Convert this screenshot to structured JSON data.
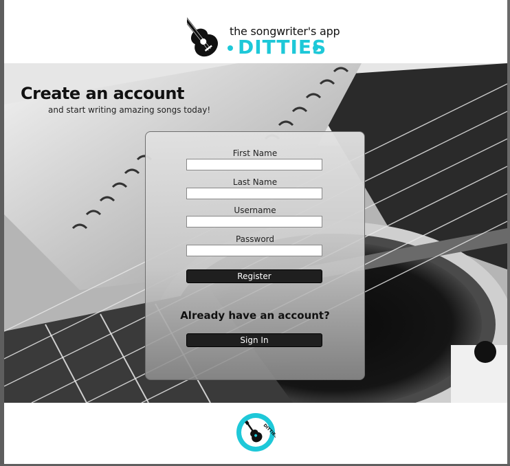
{
  "header": {
    "tagline": "the songwriter's app",
    "brand": "DITTIES"
  },
  "hero": {
    "title": "Create an account",
    "subtitle": "and start writing amazing songs today!"
  },
  "form": {
    "first_name_label": "First Name",
    "first_name_value": "",
    "last_name_label": "Last Name",
    "last_name_value": "",
    "username_label": "Username",
    "username_value": "",
    "password_label": "Password",
    "password_value": "",
    "register_label": "Register",
    "have_account_text": "Already have an account?",
    "sign_in_label": "Sign In"
  },
  "footer": {
    "logo_text": "DITTIES",
    "logo_ring_text": "the songwriter's app"
  },
  "colors": {
    "accent": "#1ec8d8",
    "button": "#1f1f1f"
  },
  "icons": {
    "header_logo": "guitar-icon",
    "footer_logo": "guitar-badge-icon"
  }
}
